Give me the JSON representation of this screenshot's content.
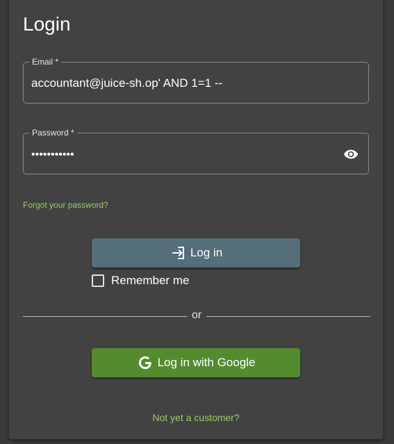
{
  "login": {
    "title": "Login",
    "email": {
      "label": "Email *",
      "value": "accountant@juice-sh.op' AND 1=1 --"
    },
    "password": {
      "label": "Password *",
      "value": "•••••••••••"
    },
    "forgot_password": "Forgot your password?",
    "login_button": "Log in",
    "remember_me": "Remember me",
    "divider_text": "or",
    "google_button": "Log in with Google",
    "not_customer": "Not yet a customer?"
  },
  "icons": {
    "password_visibility": "eye-icon",
    "login": "login-icon",
    "google": "google-icon",
    "checkbox": "checkbox-unchecked"
  },
  "colors": {
    "card_background": "#424242",
    "login_button": "#546e7a",
    "google_button": "#558b2f",
    "link": "#9ccc65"
  }
}
